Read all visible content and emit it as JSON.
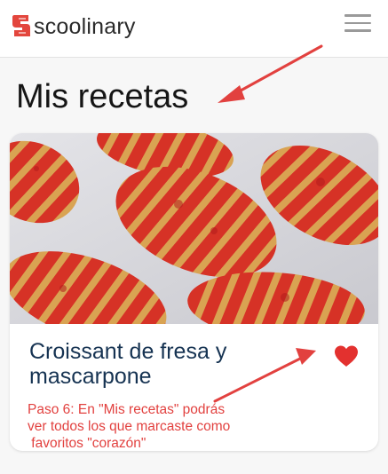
{
  "header": {
    "brand": "scoolinary",
    "logo_icon": "scoolinary-s-logo-icon",
    "menu_icon": "hamburger-menu-icon"
  },
  "page": {
    "title": "Mis recetas"
  },
  "recipe_card": {
    "image": "strawberry-croissants-photo",
    "title": "Croissant de fresa y mascarpone",
    "favorite_icon": "heart-icon",
    "favorited": true
  },
  "annotation": {
    "text": "Paso 6: En \"Mis recetas\" podrás ver todos los que marcaste como favoritos \"corazón\"",
    "lines": [
      "Paso 6: En \"Mis recetas\" podrás",
      "ver todos los que marcaste como",
      " favoritos \"corazón\""
    ]
  },
  "colors": {
    "brand_red": "#e3463d",
    "annotation_red": "#e2413f",
    "title_navy": "#163352",
    "heart_red": "#e3312f"
  }
}
